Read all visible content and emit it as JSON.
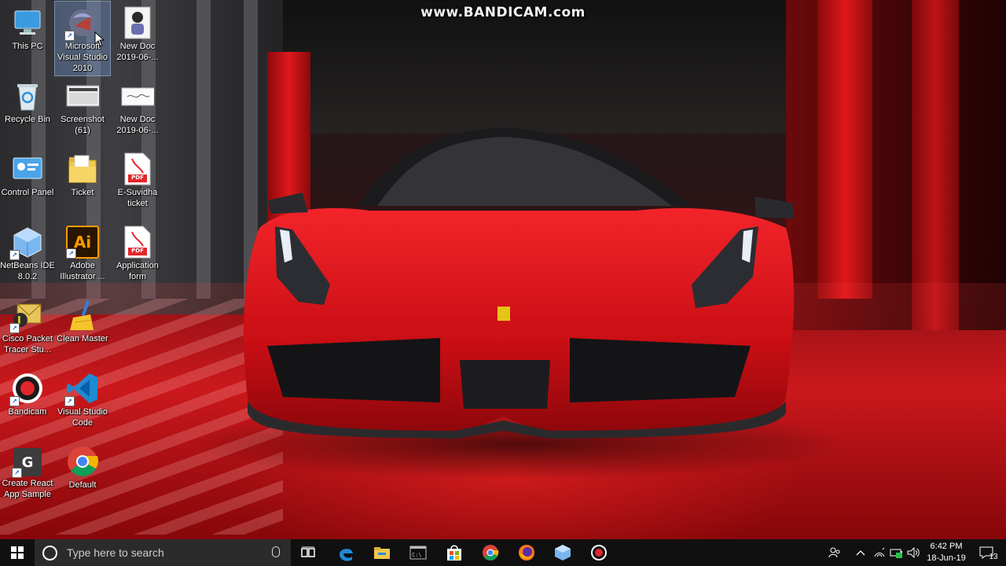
{
  "watermark": "www.BANDICAM.com",
  "desktop": {
    "icons": [
      {
        "label": "This PC",
        "icon": "this-pc-icon"
      },
      {
        "label": "Microsoft Visual Studio 2010",
        "icon": "visual-studio-2010-icon"
      },
      {
        "label": "New Doc 2019-06-...",
        "icon": "document-photo-icon"
      },
      {
        "label": "Recycle Bin",
        "icon": "recycle-bin-icon"
      },
      {
        "label": "Screenshot (61)",
        "icon": "screenshot-image-icon"
      },
      {
        "label": "New Doc 2019-06-...",
        "icon": "document-scan-icon"
      },
      {
        "label": "Control Panel",
        "icon": "control-panel-icon"
      },
      {
        "label": "Ticket",
        "icon": "folder-icon"
      },
      {
        "label": "E-Suvidha ticket",
        "icon": "pdf-icon"
      },
      {
        "label": "NetBeans IDE 8.0.2",
        "icon": "netbeans-icon"
      },
      {
        "label": "Adobe Illustrator ...",
        "icon": "adobe-illustrator-icon"
      },
      {
        "label": "Application form",
        "icon": "pdf-icon"
      },
      {
        "label": "Cisco Packet Tracer Stu...",
        "icon": "cisco-packet-tracer-icon"
      },
      {
        "label": "Clean Master",
        "icon": "broom-icon"
      },
      {
        "label": "Bandicam",
        "icon": "bandicam-icon"
      },
      {
        "label": "Visual Studio Code",
        "icon": "vscode-icon"
      },
      {
        "label": "Create React App Sample",
        "icon": "app-shortcut-icon"
      },
      {
        "label": "Default",
        "icon": "chrome-icon"
      }
    ],
    "illustrator_glyph": "Ai",
    "pdf_glyph": "PDF",
    "app_sample_glyph": "G"
  },
  "taskbar": {
    "search_placeholder": "Type here to search",
    "apps": [
      "task-view-icon",
      "edge-icon",
      "file-explorer-icon",
      "command-prompt-icon",
      "store-icon",
      "chrome-icon",
      "firefox-icon",
      "virtualbox-icon",
      "bandicam-record-icon"
    ],
    "clock_time": "6:42 PM",
    "clock_date": "18-Jun-19",
    "notification_count": "13"
  },
  "colors": {
    "taskbar_bg": "#101010",
    "search_bg": "#2b2b2b",
    "car_red": "#d8131a"
  }
}
